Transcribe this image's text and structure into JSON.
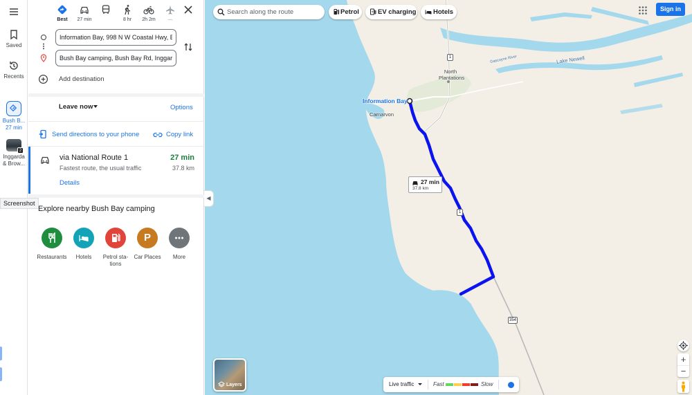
{
  "rail": {
    "menu_label": "",
    "saved": "Saved",
    "recents": "Recents",
    "trip_line1": "Bush B...",
    "trip_line2": "27 min",
    "place_line1": "Inggarda",
    "place_line2": "& Brow...",
    "place_badge": "2"
  },
  "modes": [
    {
      "name": "best",
      "label": "Best"
    },
    {
      "name": "driving",
      "label": "27 min"
    },
    {
      "name": "transit",
      "label": ""
    },
    {
      "name": "walking",
      "label": "8 hr"
    },
    {
      "name": "cycling",
      "label": "2h 2m"
    },
    {
      "name": "flights",
      "label": "—"
    }
  ],
  "origin_value": "Information Bay, 998 N W Coastal Hwy, B",
  "destination_value": "Bush Bay camping, Bush Bay Rd, Inggarda",
  "add_destination": "Add destination",
  "leave_now": "Leave now",
  "options": "Options",
  "send_directions": "Send directions to your phone",
  "copy_link": "Copy link",
  "route": {
    "name": "via National Route 1",
    "description": "Fastest route, the usual traffic",
    "time": "27 min",
    "distance": "37.8 km",
    "details": "Details"
  },
  "explore_title": "Explore nearby Bush Bay camping",
  "nearby": [
    {
      "label": "Restaurants",
      "color": "#1e8e3e",
      "icon": "restaurant-icon"
    },
    {
      "label": "Hotels",
      "color": "#12a4b6",
      "icon": "hotel-icon"
    },
    {
      "label": "Petrol sta- tions",
      "color": "#e0443b",
      "icon": "petrol-icon"
    },
    {
      "label": "Car Places",
      "color": "#c77a1f",
      "icon": "parking-icon"
    },
    {
      "label": "More",
      "color": "#70757a",
      "icon": "more-icon"
    }
  ],
  "tooltip": "Screenshot",
  "map": {
    "search_placeholder": "Search along the route",
    "chips": [
      "Petrol",
      "EV charging",
      "Hotels"
    ],
    "sign_in": "Sign in",
    "labels": {
      "information_bay": "Information Bay",
      "carnarvon": "Carnarvon",
      "north_plantations": "North Plantations",
      "lake_newell": "Lake Newell",
      "gascoyne": "Gascoyne River"
    },
    "route_tag_time": "27 min",
    "route_tag_distance": "37.8 km",
    "shields": [
      "1",
      "1",
      "354"
    ],
    "layers": "Layers",
    "live_traffic": "Live traffic",
    "fast": "Fast",
    "slow": "Slow",
    "traffic_colors": [
      "#63d668",
      "#ffcf4a",
      "#f23c32",
      "#811f1f"
    ],
    "zoom_in": "+",
    "zoom_out": "−"
  },
  "colors": {
    "accent": "#1a73e8",
    "route": "#1a1aff",
    "water": "#a4d8ec",
    "land": "#f3efe6"
  }
}
